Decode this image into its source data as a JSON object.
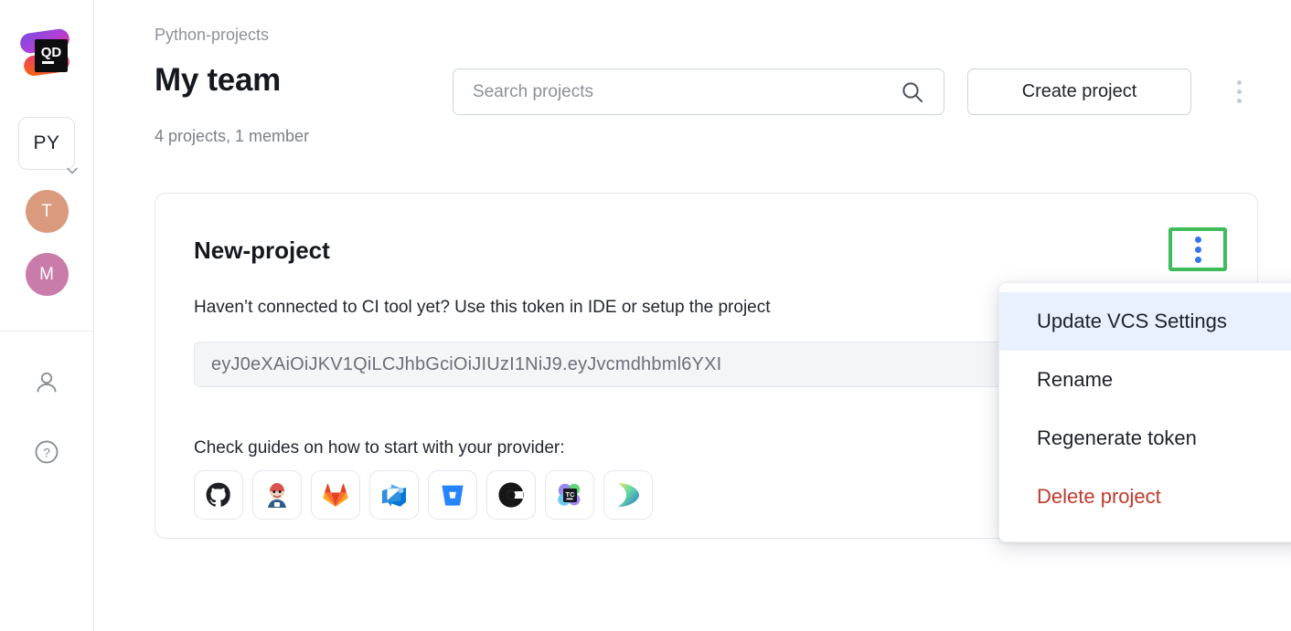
{
  "sidebar": {
    "logo": {
      "name": "qodana-logo",
      "text": "QD"
    },
    "project_selector": {
      "label": "PY",
      "icon": "chevron-down-icon"
    },
    "avatars": [
      {
        "initial": "T",
        "color": "#d99a7d"
      },
      {
        "initial": "M",
        "color": "#c97ca9"
      }
    ],
    "bottom_icons": [
      {
        "name": "person-icon"
      },
      {
        "name": "help-icon",
        "glyph": "?"
      }
    ]
  },
  "header": {
    "breadcrumb": "Python-projects",
    "title": "My team",
    "subtitle": "4 projects, 1 member",
    "search": {
      "placeholder": "Search projects",
      "value": "",
      "icon": "search-icon"
    },
    "create_button": "Create project",
    "more_menu_icon": "kebab-menu-icon"
  },
  "project_card": {
    "title": "New-project",
    "description": "Haven’t connected to CI tool yet? Use this token in IDE or setup the project",
    "token": "eyJ0eXAiOiJKV1QiLCJhbGciOiJIUzI1NiJ9.eyJvcmdhbml6YXI",
    "guides_label": "Check guides on how to start with your provider:",
    "providers": [
      {
        "name": "github-icon",
        "label": "GitHub"
      },
      {
        "name": "jenkins-icon",
        "label": "Jenkins"
      },
      {
        "name": "gitlab-icon",
        "label": "GitLab"
      },
      {
        "name": "azure-devops-icon",
        "label": "Azure DevOps"
      },
      {
        "name": "bitbucket-icon",
        "label": "Bitbucket"
      },
      {
        "name": "circleci-icon",
        "label": "CircleCI"
      },
      {
        "name": "teamcity-icon",
        "label": "TeamCity"
      },
      {
        "name": "jetbrains-space-icon",
        "label": "Space"
      }
    ],
    "kebab_icon": "kebab-menu-icon"
  },
  "dropdown_menu": {
    "items": [
      {
        "label": "Update VCS Settings",
        "highlighted": true,
        "danger": false
      },
      {
        "label": "Rename",
        "highlighted": false,
        "danger": false
      },
      {
        "label": "Regenerate token",
        "highlighted": false,
        "danger": false
      },
      {
        "label": "Delete project",
        "highlighted": false,
        "danger": true
      }
    ]
  },
  "colors": {
    "accent_blue": "#3574f0",
    "highlight_green": "#3ebd5a",
    "danger_red": "#c0392b",
    "menu_highlight_bg": "#e8f1fd"
  }
}
